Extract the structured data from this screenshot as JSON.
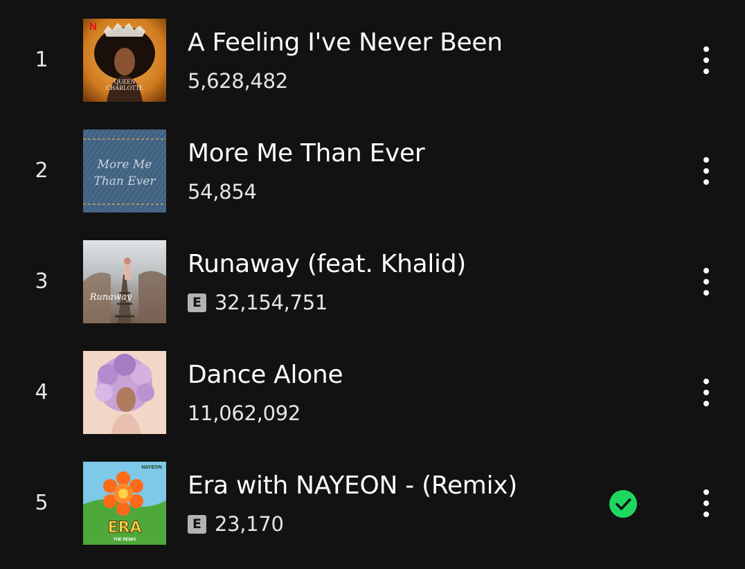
{
  "tracks": [
    {
      "rank": "1",
      "title": "A Feeling I've Never Been",
      "plays": "5,628,482",
      "explicit": false,
      "saved": false,
      "cover_icon": "queen-charlotte-cover",
      "cover_text": {
        "brand": "N",
        "line1": "QUEEN",
        "line2": "CHARLOTTE"
      }
    },
    {
      "rank": "2",
      "title": "More Me Than Ever",
      "plays": "54,854",
      "explicit": false,
      "saved": false,
      "cover_icon": "denim-script-cover",
      "cover_text": {
        "line1": "More Me",
        "line2": "Than Ever"
      }
    },
    {
      "rank": "3",
      "title": "Runaway (feat. Khalid)",
      "plays": "32,154,751",
      "explicit": true,
      "saved": false,
      "cover_icon": "railway-tracks-cover",
      "cover_text": {
        "line1": "Runaway"
      }
    },
    {
      "rank": "4",
      "title": "Dance Alone",
      "plays": "11,062,092",
      "explicit": false,
      "saved": false,
      "cover_icon": "flower-hair-portrait-cover"
    },
    {
      "rank": "5",
      "title": "Era with NAYEON - (Remix)",
      "plays": "23,170",
      "explicit": true,
      "saved": true,
      "cover_icon": "era-flower-cover",
      "cover_text": {
        "brand": "NAYEON",
        "line1": "ERA",
        "line2": "THE REMIX"
      }
    }
  ],
  "explicit_label": "E",
  "colors": {
    "background": "#121212",
    "text_primary": "#ffffff",
    "text_secondary": "#e6e6e6",
    "explicit_badge": "#b3b3b3",
    "saved_green": "#1ed760"
  }
}
